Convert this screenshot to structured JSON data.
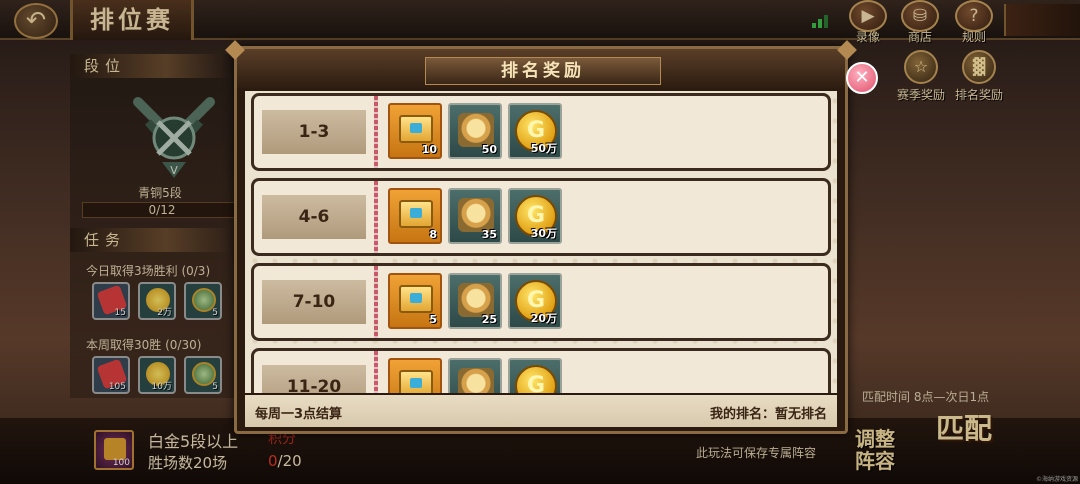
{
  "header": {
    "title": "排位赛",
    "back_icon": "back-arrow-icon",
    "buttons": [
      {
        "label": "录像",
        "icon": "video-icon"
      },
      {
        "label": "商店",
        "icon": "shop-cart-icon"
      },
      {
        "label": "规则",
        "icon": "question-icon"
      }
    ]
  },
  "right_icons": [
    {
      "label": "赛季奖励",
      "icon": "trophy-icon"
    },
    {
      "label": "排名奖励",
      "icon": "podium-icon"
    }
  ],
  "left_panel": {
    "rank_section": "段位",
    "rank_name": "青铜5段",
    "rank_progress": "0/12",
    "rank_emblem_text": "V",
    "task_section": "任务",
    "tasks": [
      {
        "text": "今日取得3场胜利 (0/3)",
        "rewards": [
          "15",
          "2万",
          "5"
        ]
      },
      {
        "text": "本周取得30胜 (0/30)",
        "rewards": [
          "105",
          "10万",
          "5"
        ]
      }
    ]
  },
  "bottom": {
    "item_count": "100",
    "line1": "白金5段以上",
    "line1_suffix": "积分",
    "line2": "胜场数20场",
    "count_current": "0",
    "count_total": "/20",
    "save_text": "此玩法可保存专属阵容",
    "match_time": "匹配时间 8点—次日1点",
    "adjust_label": "调整阵容",
    "match_label": "匹配",
    "watermark": "©海纳游戏资源"
  },
  "modal": {
    "title": "排名奖励",
    "rows": [
      {
        "rank": "1-3",
        "chest": "10",
        "puzzle": "50",
        "gold": "50万"
      },
      {
        "rank": "4-6",
        "chest": "8",
        "puzzle": "35",
        "gold": "30万"
      },
      {
        "rank": "7-10",
        "chest": "5",
        "puzzle": "25",
        "gold": "20万"
      },
      {
        "rank": "11-20",
        "chest": "",
        "puzzle": "",
        "gold": ""
      }
    ],
    "footer_left": "每周一3点结算",
    "footer_right": "我的排名：暂无排名",
    "close_icon": "close-x-icon"
  },
  "colors": {
    "accent_gold": "#f3dfb1",
    "modal_bg": "#ece2d0",
    "slot_orange": "#f0a236",
    "slot_teal": "#4c6e6a"
  }
}
